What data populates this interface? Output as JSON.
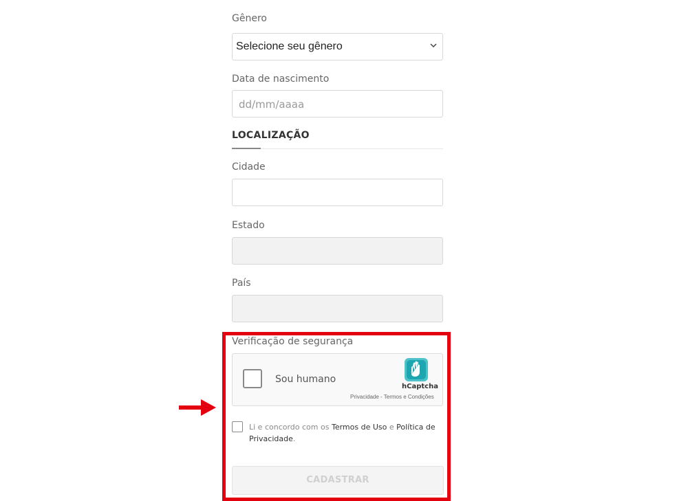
{
  "form": {
    "gender": {
      "label": "Gênero",
      "value": "Selecione seu gênero"
    },
    "birthdate": {
      "label": "Data de nascimento",
      "placeholder": "dd/mm/aaaa"
    },
    "location_section": {
      "title": "LOCALIZAÇÃO"
    },
    "city": {
      "label": "Cidade",
      "value": ""
    },
    "state": {
      "label": "Estado",
      "value": ""
    },
    "country": {
      "label": "País",
      "value": ""
    }
  },
  "security": {
    "label": "Verificação de segurança",
    "captcha": {
      "checkbox_label": "Sou humano",
      "brand": "hCaptcha",
      "privacy_link": "Privacidade",
      "separator": " - ",
      "terms_link": "Termos e Condições"
    }
  },
  "terms": {
    "prefix": "Li e concordo com os ",
    "terms_link": "Termos de Uso",
    "connector": " e ",
    "privacy_link": "Política de Privacidade",
    "suffix": "."
  },
  "submit": {
    "label": "CADASTRAR"
  },
  "annotation": {
    "highlight_color": "#e3000f"
  }
}
